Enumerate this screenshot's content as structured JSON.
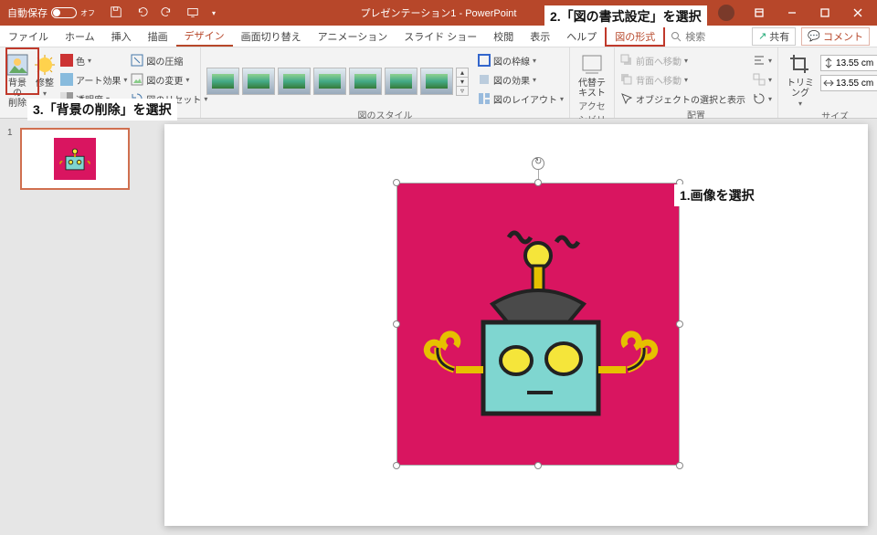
{
  "titlebar": {
    "autosave_label": "自動保存",
    "autosave_state": "オフ",
    "title": "プレゼンテーション1 - PowerPoint"
  },
  "tabs": {
    "file": "ファイル",
    "home": "ホーム",
    "insert": "挿入",
    "draw": "描画",
    "design": "デザイン",
    "transitions": "画面切り替え",
    "animations": "アニメーション",
    "slideshow": "スライド ショー",
    "review": "校閲",
    "view": "表示",
    "help": "ヘルプ",
    "picture_format": "図の形式",
    "search_placeholder": "検索"
  },
  "share": {
    "share": "共有",
    "comment": "コメント"
  },
  "ribbon": {
    "remove_bg": "背景の\n削除",
    "corrections": "修整",
    "color": "色",
    "artistic": "アート効果",
    "transparency": "透明度",
    "compress": "図の圧縮",
    "change": "図の変更",
    "reset": "図のリセット",
    "styles_label": "図のスタイル",
    "border": "図の枠線",
    "effects": "図の効果",
    "layout": "図のレイアウト",
    "alt_text": "代替テ\nキスト",
    "access_label": "アクセシビリティ",
    "bring_fwd": "前面へ移動",
    "send_back": "背面へ移動",
    "selection_pane": "オブジェクトの選択と表示",
    "arrange_label": "配置",
    "crop": "トリミング",
    "height": "13.55 cm",
    "width": "13.55 cm",
    "size_label": "サイズ"
  },
  "annotations": {
    "a1": "1.画像を選択",
    "a2": "2.「図の書式設定」を選択",
    "a3": "3.「背景の削除」を選択"
  },
  "thumbnail": {
    "num": "1"
  }
}
